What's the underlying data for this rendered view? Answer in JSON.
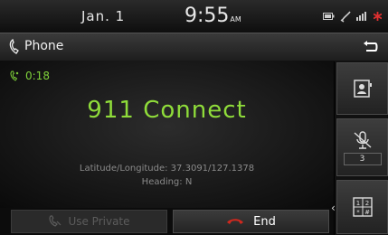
{
  "status": {
    "date": "Jan. 1",
    "time": "9:55",
    "ampm": "AM",
    "icons": [
      "battery-icon",
      "bluetooth-icon",
      "signal-icon",
      "alert-icon"
    ]
  },
  "header": {
    "title": "Phone",
    "back_icon": "back-icon",
    "phone_icon": "phone-icon"
  },
  "call": {
    "timer": "0:18",
    "name": "911 Connect",
    "location_line": "Latitude/Longitude: 37.3091/127.1378",
    "heading_line": "Heading: N"
  },
  "buttons": {
    "use_private": "Use Private",
    "end": "End"
  },
  "side": {
    "contacts_icon": "contacts-icon",
    "mute_icon": "mic-mute-icon",
    "volume": "3",
    "keypad_icon": "keypad-icon",
    "keypad_digits": [
      "1",
      "2",
      "*",
      "#"
    ]
  },
  "colors": {
    "accent_green": "#8fdc3a",
    "end_red": "#d0281e"
  }
}
